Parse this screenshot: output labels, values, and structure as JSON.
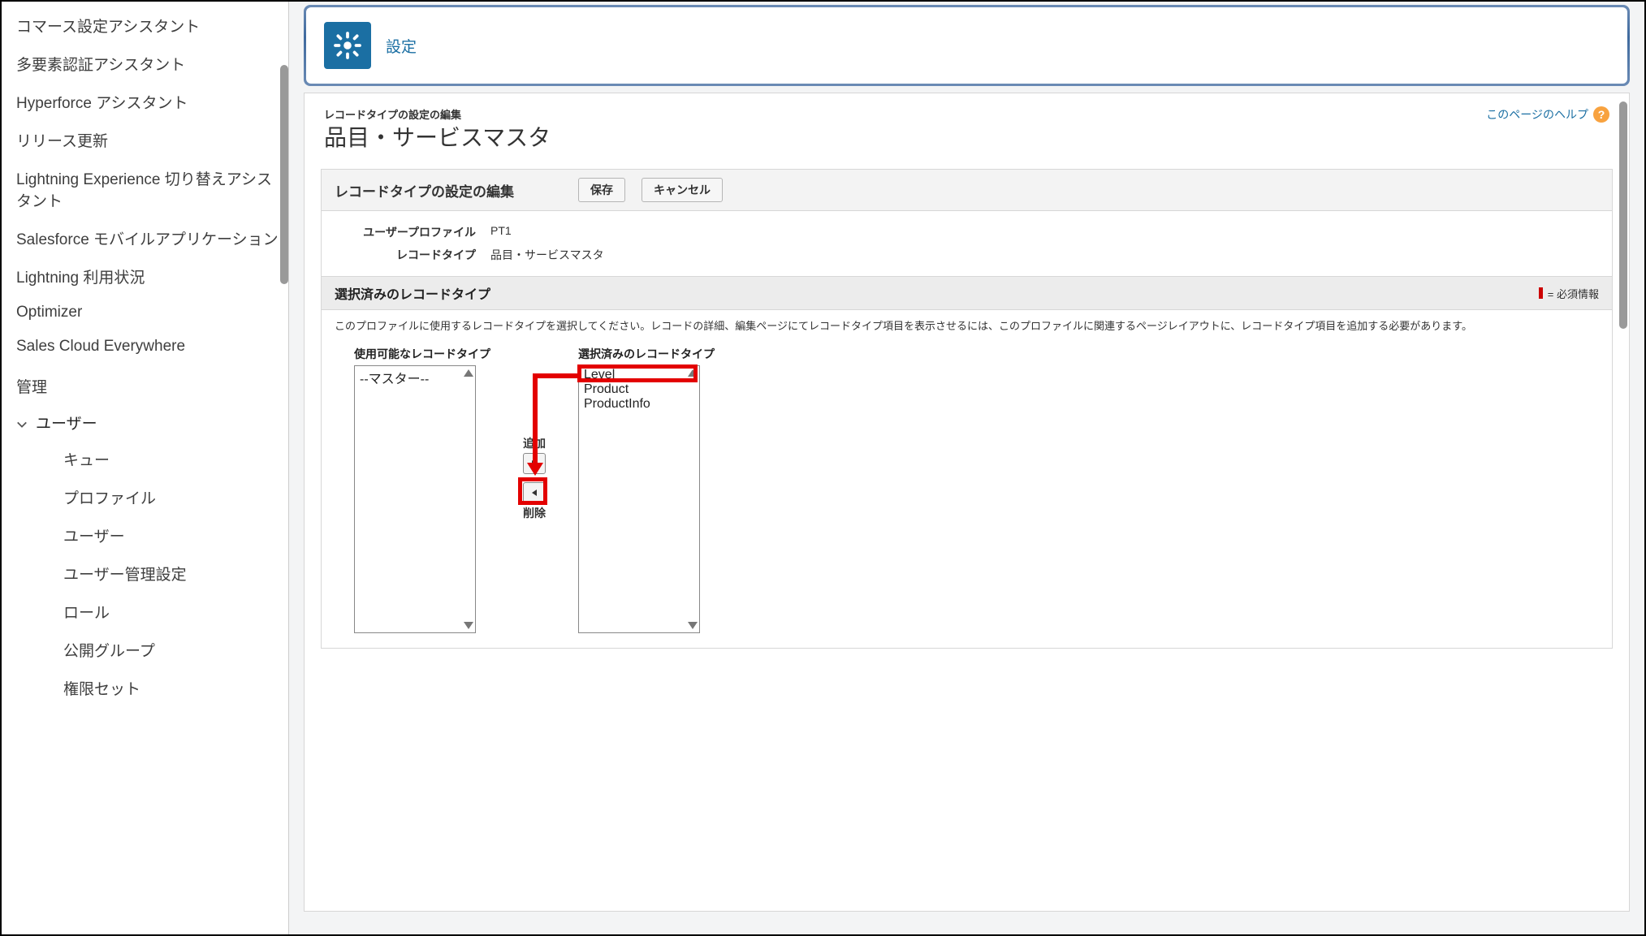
{
  "sidebar": {
    "items": [
      "コマース設定アシスタント",
      "多要素認証アシスタント",
      "Hyperforce アシスタント",
      "リリース更新",
      "Lightning Experience 切り替えアシスタント",
      "Salesforce モバイルアプリケーション",
      "Lightning 利用状況",
      "Optimizer",
      "Sales Cloud Everywhere"
    ],
    "sectionLabel": "管理",
    "expanded": {
      "label": "ユーザー",
      "children": [
        "キュー",
        "プロファイル",
        "ユーザー",
        "ユーザー管理設定",
        "ロール",
        "公開グループ",
        "権限セット"
      ]
    }
  },
  "header": {
    "title": "設定"
  },
  "page": {
    "pretitle": "レコードタイプの設定の編集",
    "title": "品目・サービスマスタ",
    "helpLink": "このページのヘルプ"
  },
  "editSection": {
    "title": "レコードタイプの設定の編集",
    "saveLabel": "保存",
    "cancelLabel": "キャンセル",
    "rows": {
      "profileLabel": "ユーザープロファイル",
      "profileValue": "PT1",
      "recordTypeLabel": "レコードタイプ",
      "recordTypeValue": "品目・サービスマスタ"
    }
  },
  "selectedSection": {
    "title": "選択済みのレコードタイプ",
    "requiredLegend": "= 必須情報",
    "description": "このプロファイルに使用するレコードタイプを選択してください。レコードの詳細、編集ページにてレコードタイプ項目を表示させるには、このプロファイルに関連するページレイアウトに、レコードタイプ項目を追加する必要があります。"
  },
  "dualList": {
    "availableLabel": "使用可能なレコードタイプ",
    "selectedLabel": "選択済みのレコードタイプ",
    "available": [
      "--マスター--"
    ],
    "selected": [
      "Level",
      "Product",
      "ProductInfo"
    ],
    "addLabel": "追加",
    "removeLabel": "削除"
  }
}
